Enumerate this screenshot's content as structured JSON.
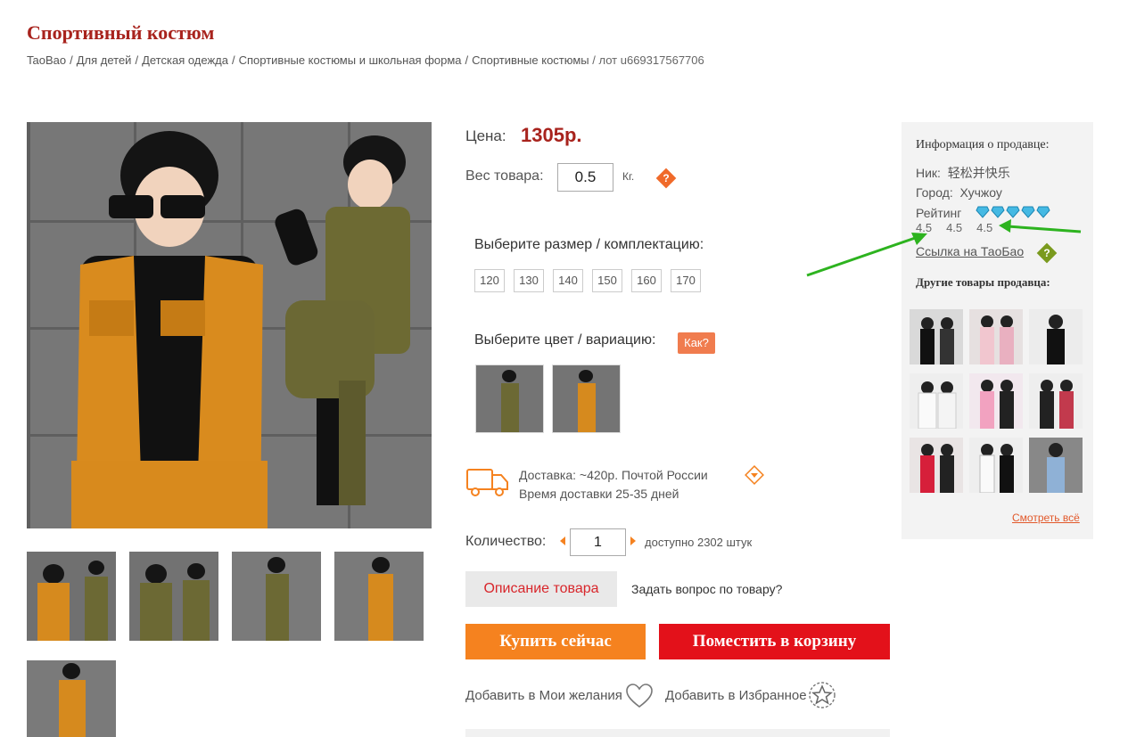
{
  "page": {
    "title": "Спортивный костюм"
  },
  "breadcrumb": [
    {
      "label": "TaoBao"
    },
    {
      "label": "Для детей"
    },
    {
      "label": "Детская одежда"
    },
    {
      "label": "Спортивные костюмы и школьная форма"
    },
    {
      "label": "Спортивные костюмы"
    }
  ],
  "lot": "/ лот u669317567706",
  "product": {
    "price_label": "Цена:",
    "price": "1305р.",
    "weight_label": "Вес товара:",
    "weight_value": "0.5",
    "weight_unit": "Кг.",
    "help_glyph": "?",
    "size_label": "Выберите размер / комплектацию:",
    "sizes": [
      "120",
      "130",
      "140",
      "150",
      "160",
      "170"
    ],
    "color_label": "Выберите цвет / вариацию:",
    "how_label": "Как?",
    "variant_count_images": 2,
    "delivery_line1": "Доставка: ~420р. Почтой России",
    "delivery_line2": "Время доставки 25-35 дней",
    "qty_label": "Количество:",
    "qty_value": "1",
    "qty_available": "доступно 2302 штук",
    "desc_tab": "Описание товара",
    "ask_link": "Задать вопрос по товару?",
    "buy_now": "Купить сейчас",
    "to_cart": "Поместить в корзину",
    "wishlist": "Добавить в Мои желания",
    "favorites": "Добавить в Избранное"
  },
  "seller": {
    "title": "Информация о продавце:",
    "nick_label": "Ник:",
    "nick": "轻松并快乐",
    "city_label": "Город:",
    "city": "Хучжоу",
    "rating_label": "Рейтинг",
    "rating_gems": 5,
    "scores": [
      "4.5",
      "4.5",
      "4.5"
    ],
    "taobao_link": "Ссылка на ТаоБао",
    "other_title": "Другие товары продавца:",
    "see_all": "Смотреть всё"
  },
  "colors": {
    "brand_red": "#a8231d",
    "orange": "#f5821f",
    "red_button": "#e3111a",
    "annotation_green": "#2db31f",
    "gem_blue": "#2aa9d8"
  }
}
